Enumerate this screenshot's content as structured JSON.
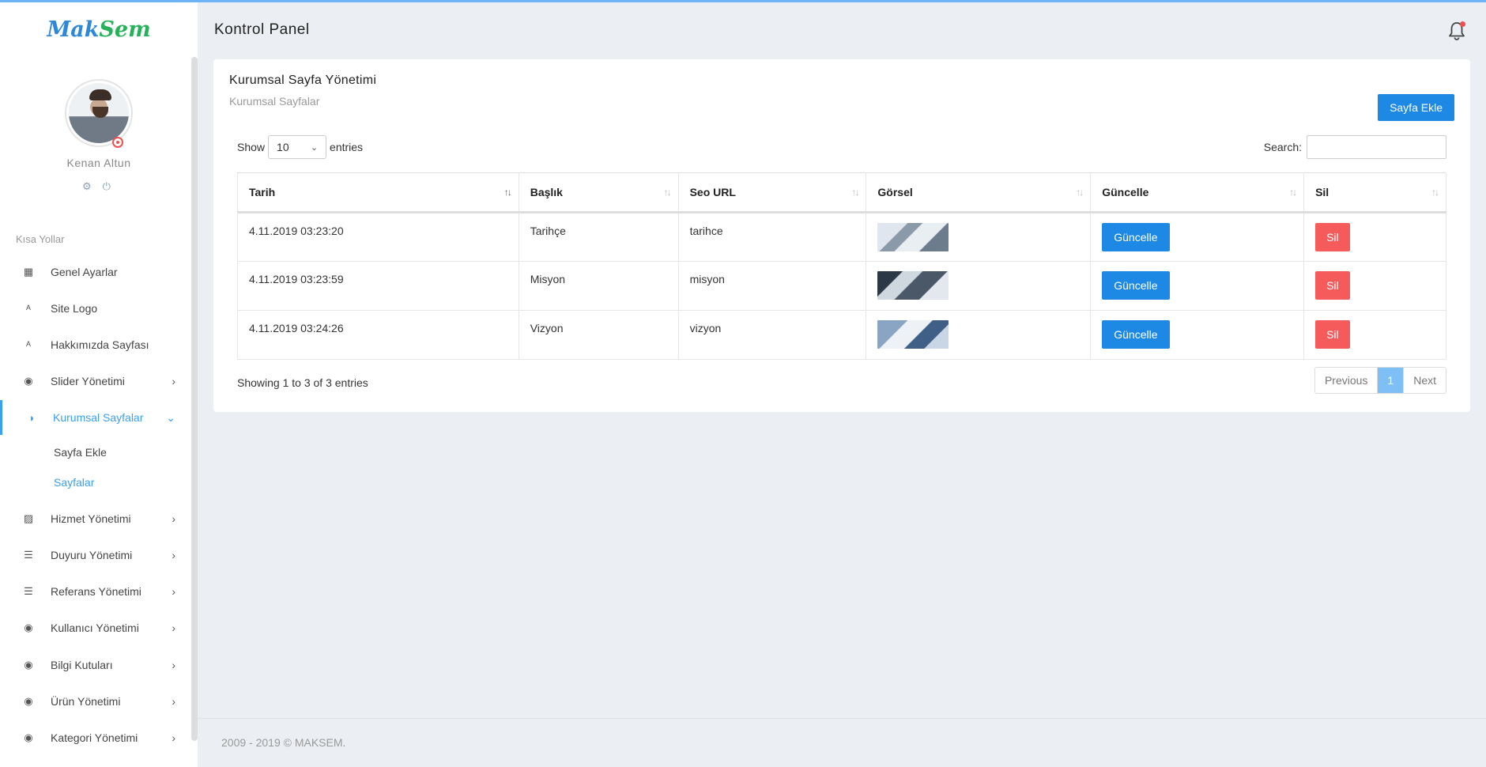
{
  "brand": {
    "part1": "Mak",
    "part2": "Sem",
    "color1": "#2d88d9",
    "color2": "#27b15a"
  },
  "user": {
    "name": "Kenan Altun",
    "icons": [
      "gear-icon",
      "power-icon"
    ]
  },
  "sidebar": {
    "section_label": "Kısa Yollar",
    "items": [
      {
        "label": "Genel Ayarlar",
        "icon": "dashboard-icon",
        "glyph": "▦"
      },
      {
        "label": "Site Logo",
        "icon": "text-format-icon",
        "glyph": "ᴬ"
      },
      {
        "label": "Hakkımızda Sayfası",
        "icon": "text-format-icon",
        "glyph": "ᴬ"
      },
      {
        "label": "Slider Yönetimi",
        "icon": "globe-icon",
        "glyph": "◉",
        "arrow": "›"
      },
      {
        "label": "Kurumsal Sayfalar",
        "icon": "contrast-icon",
        "glyph": "◑",
        "arrow": "⌄",
        "active": true
      },
      {
        "label": "Hizmet Yönetimi",
        "icon": "texture-icon",
        "glyph": "▨",
        "arrow": "›"
      },
      {
        "label": "Duyuru Yönetimi",
        "icon": "list-icon",
        "glyph": "☰",
        "arrow": "›"
      },
      {
        "label": "Referans Yönetimi",
        "icon": "list-icon",
        "glyph": "☰",
        "arrow": "›"
      },
      {
        "label": "Kullanıcı Yönetimi",
        "icon": "globe-icon",
        "glyph": "◉",
        "arrow": "›"
      },
      {
        "label": "Bilgi Kutuları",
        "icon": "globe-icon",
        "glyph": "◉",
        "arrow": "›"
      },
      {
        "label": "Ürün Yönetimi",
        "icon": "globe-icon",
        "glyph": "◉",
        "arrow": "›"
      },
      {
        "label": "Kategori Yönetimi",
        "icon": "globe-icon",
        "glyph": "◉",
        "arrow": "›"
      }
    ],
    "submenu": [
      {
        "label": "Sayfa Ekle"
      },
      {
        "label": "Sayfalar",
        "active": true
      }
    ],
    "active_color": "#3aa0f0"
  },
  "header": {
    "title": "Kontrol Panel"
  },
  "card": {
    "title": "Kurumsal Sayfa Yönetimi",
    "subtitle": "Kurumsal Sayfalar",
    "add_button": "Sayfa Ekle",
    "show_label": "Show",
    "show_value": "10",
    "entries_label": "entries",
    "search_label": "Search:",
    "search_value": ""
  },
  "table": {
    "columns": [
      "Tarih",
      "Başlık",
      "Seo URL",
      "Görsel",
      "Güncelle",
      "Sil"
    ],
    "rows": [
      {
        "date": "4.11.2019 03:23:20",
        "title": "Tarihçe",
        "seo": "tarihce",
        "update": "Güncelle",
        "delete": "Sil"
      },
      {
        "date": "4.11.2019 03:23:59",
        "title": "Misyon",
        "seo": "misyon",
        "update": "Güncelle",
        "delete": "Sil"
      },
      {
        "date": "4.11.2019 03:24:26",
        "title": "Vizyon",
        "seo": "vizyon",
        "update": "Güncelle",
        "delete": "Sil"
      }
    ]
  },
  "pagination": {
    "info": "Showing 1 to 3 of 3 entries",
    "previous": "Previous",
    "current": "1",
    "next": "Next"
  },
  "footer": {
    "text": "2009 - 2019 © MAKSEM."
  },
  "colors": {
    "primary": "#1e88e5",
    "danger": "#f55b5b",
    "background": "#ebeef2"
  }
}
